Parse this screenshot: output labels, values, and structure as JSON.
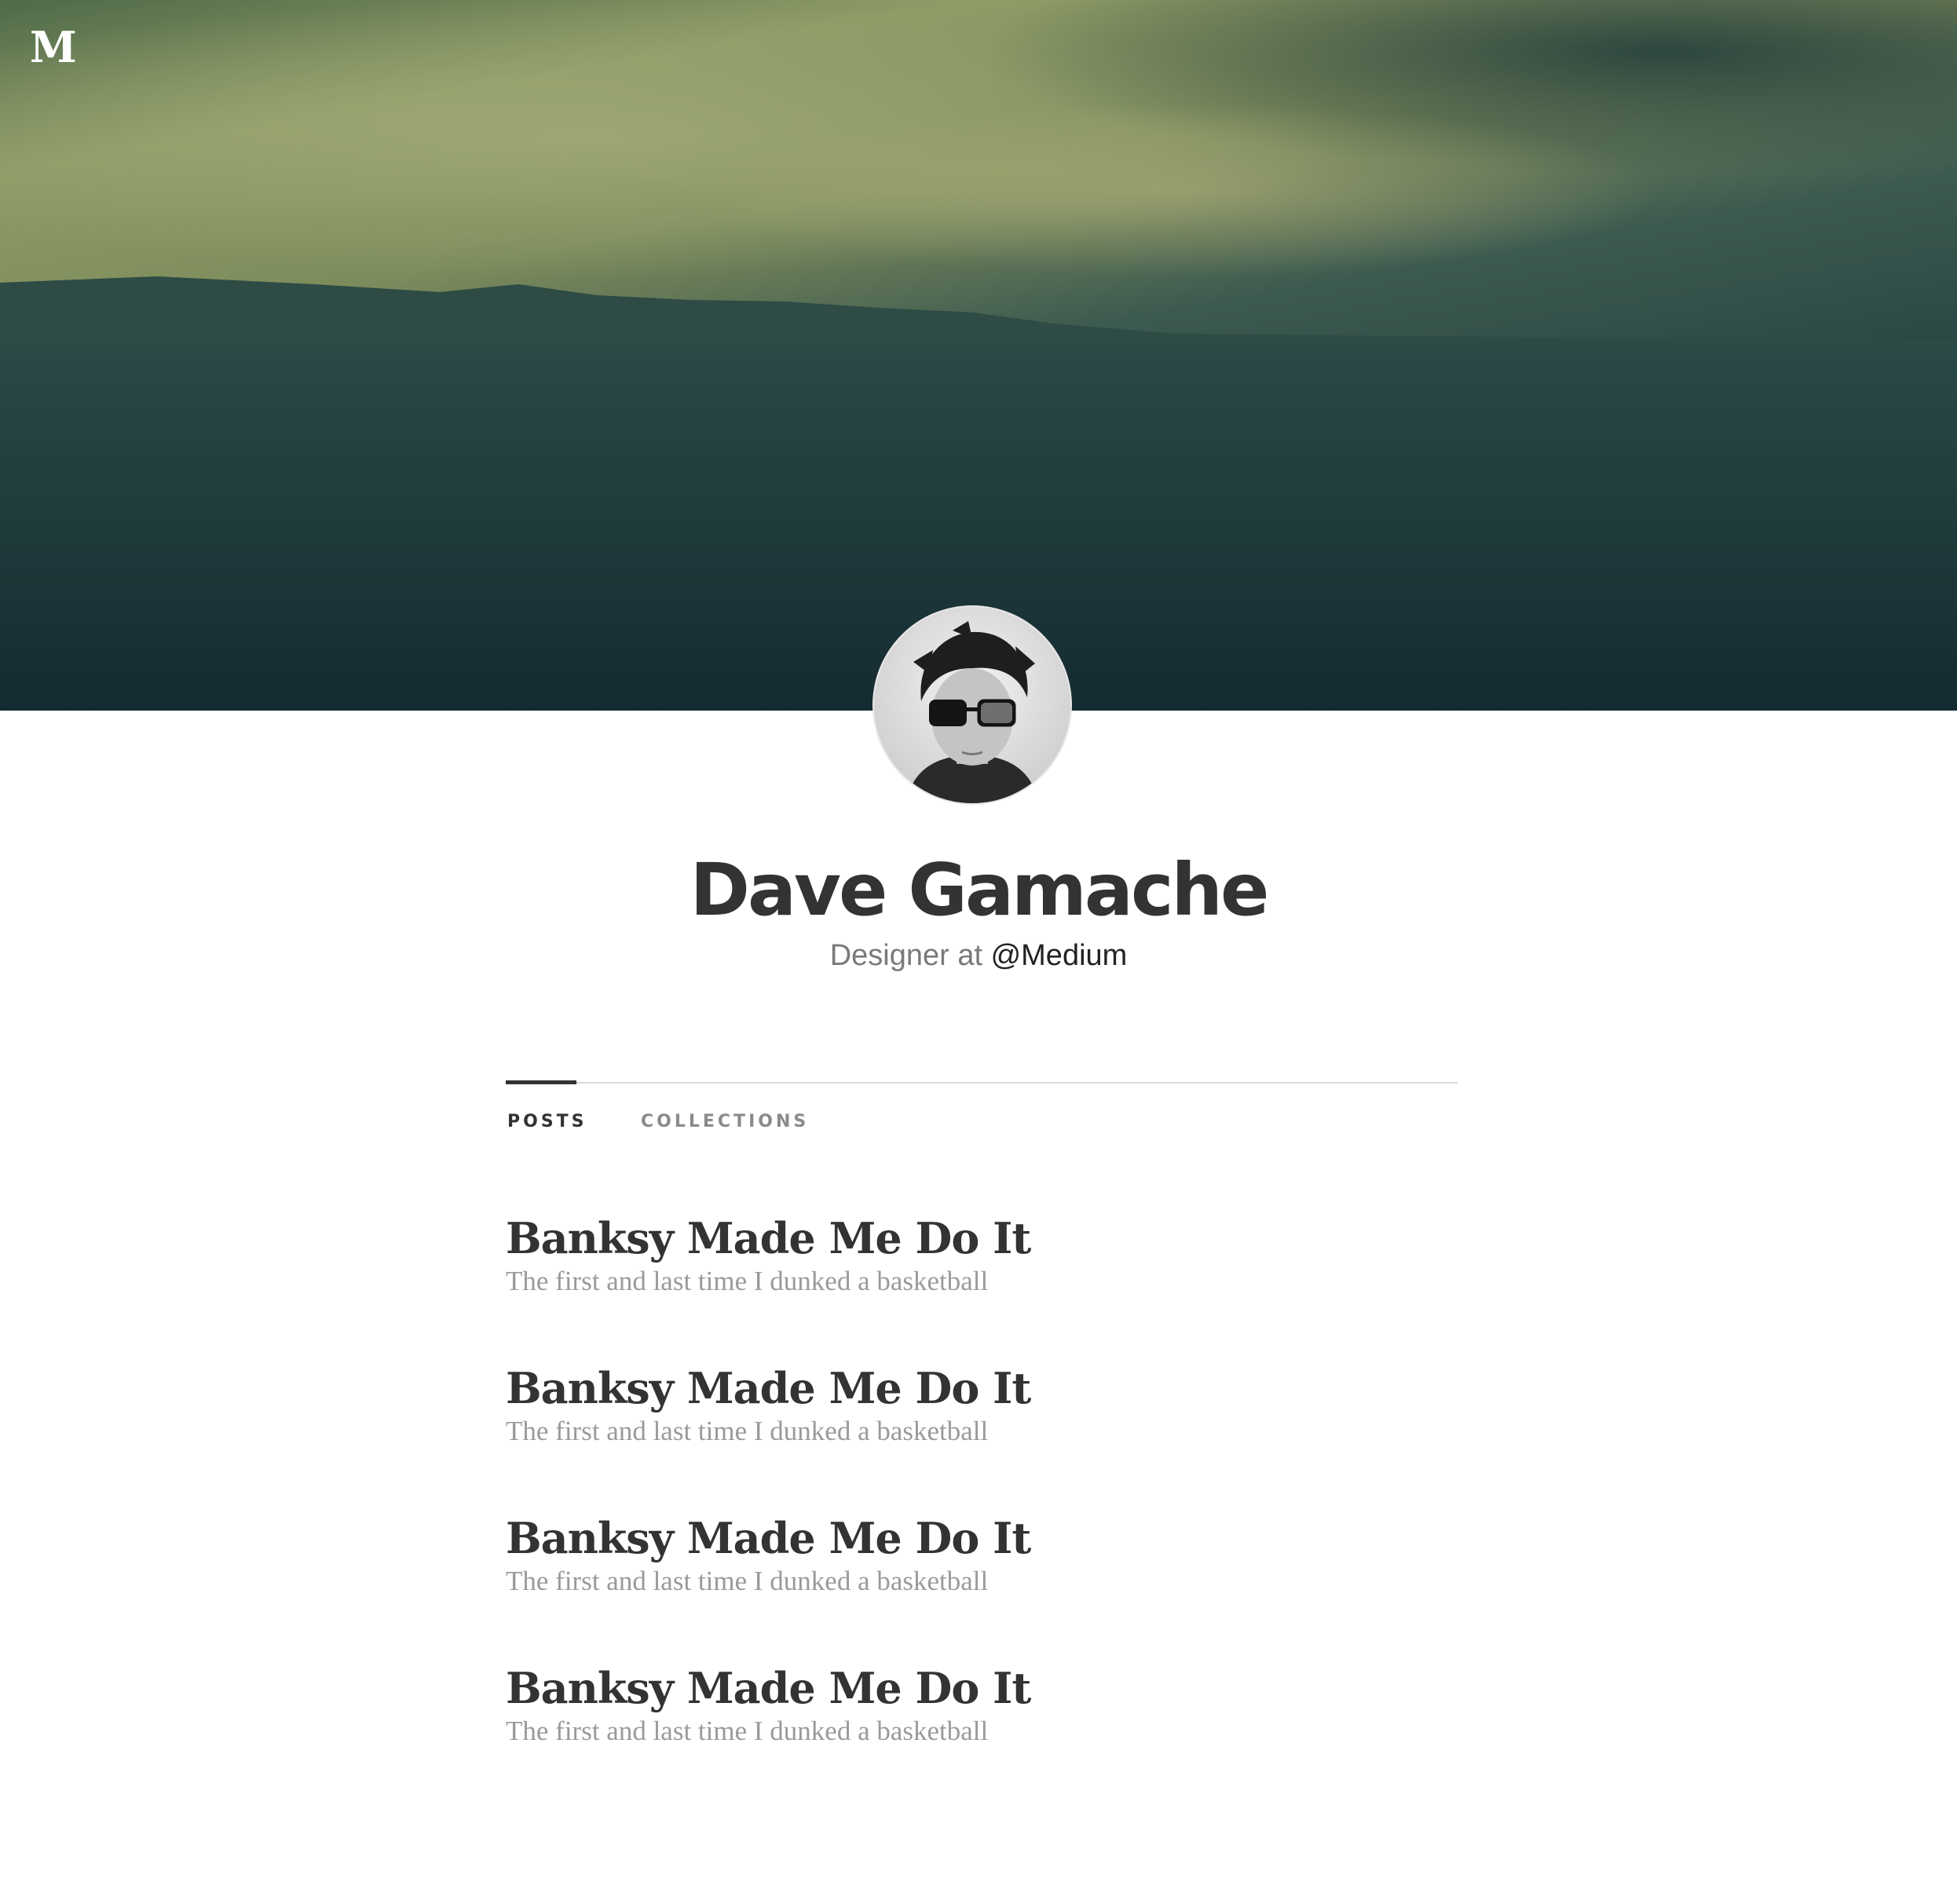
{
  "header": {
    "logo": "M"
  },
  "profile": {
    "name": "Dave Gamache",
    "bio_prefix": "Designer at ",
    "bio_handle": "@Medium"
  },
  "tabs": [
    {
      "label": "POSTS",
      "active": true
    },
    {
      "label": "COLLECTIONS",
      "active": false
    }
  ],
  "posts": [
    {
      "title": "Banksy Made Me Do It",
      "subtitle": "The first and last time I dunked a basketball"
    },
    {
      "title": "Banksy Made Me Do It",
      "subtitle": "The first and last time I dunked a basketball"
    },
    {
      "title": "Banksy Made Me Do It",
      "subtitle": "The first and last time I dunked a basketball"
    },
    {
      "title": "Banksy Made Me Do It",
      "subtitle": "The first and last time I dunked a basketball"
    }
  ],
  "colors": {
    "sky_light": "#8a9865",
    "sky_dark": "#2b4a44",
    "sea": "#1d3b3d",
    "text_dark": "#333333",
    "text_muted": "#9a9a9a"
  }
}
